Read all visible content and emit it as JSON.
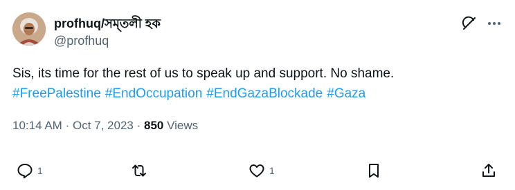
{
  "author": {
    "display_name": "profhuq/সম্‌তলী হক",
    "handle": "@profhuq"
  },
  "tweet": {
    "text": "Sis, its time for the rest of us to speak up and support.  No shame.",
    "hashtags": [
      "#FreePalestine",
      "#EndOccupation",
      "#EndGazaBlockade",
      "#Gaza"
    ]
  },
  "meta": {
    "time": "10:14 AM",
    "separator": "·",
    "date": "Oct 7, 2023",
    "views_count": "850",
    "views_label": "Views"
  },
  "actions": {
    "reply_count": "1",
    "like_count": "1"
  },
  "icons": {
    "grok": "grok-icon",
    "more": "more-icon",
    "reply": "reply-icon",
    "retweet": "retweet-icon",
    "like": "like-icon",
    "bookmark": "bookmark-icon",
    "share": "share-icon"
  },
  "colors": {
    "text": "#0f1419",
    "secondary": "#536471",
    "link": "#1d9bf0"
  }
}
